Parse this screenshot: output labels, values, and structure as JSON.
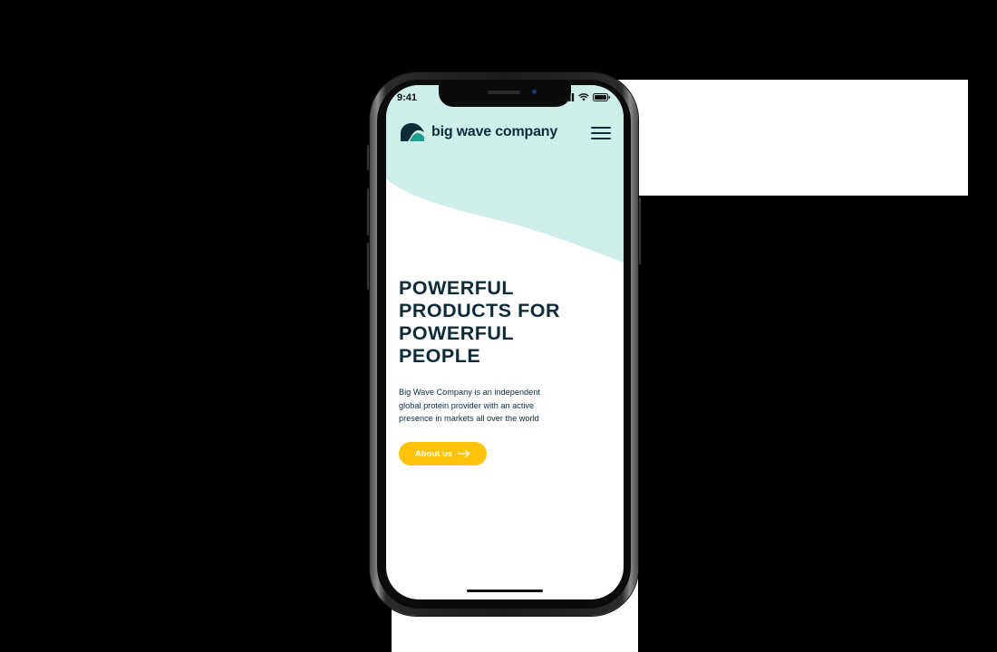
{
  "status_bar": {
    "time": "9:41"
  },
  "header": {
    "brand_name": "big wave company",
    "logo_icon": "wave-logo-icon",
    "menu_icon": "hamburger-menu-icon"
  },
  "hero": {
    "headline_lines": [
      "POWERFUL",
      "PRODUCTS FOR",
      "POWERFUL",
      "PEOPLE"
    ],
    "description_lines": [
      "Big Wave Company is an independent",
      "global protein provider with an active",
      "presence in markets all over the world"
    ],
    "cta_label": "About us",
    "cta_icon": "arrow-right-icon"
  },
  "colors": {
    "brand_navy": "#0e2b3a",
    "brand_teal": "#1e9e8c",
    "wave_mint": "#cdeee9",
    "cta_yellow": "#fdc30a"
  }
}
